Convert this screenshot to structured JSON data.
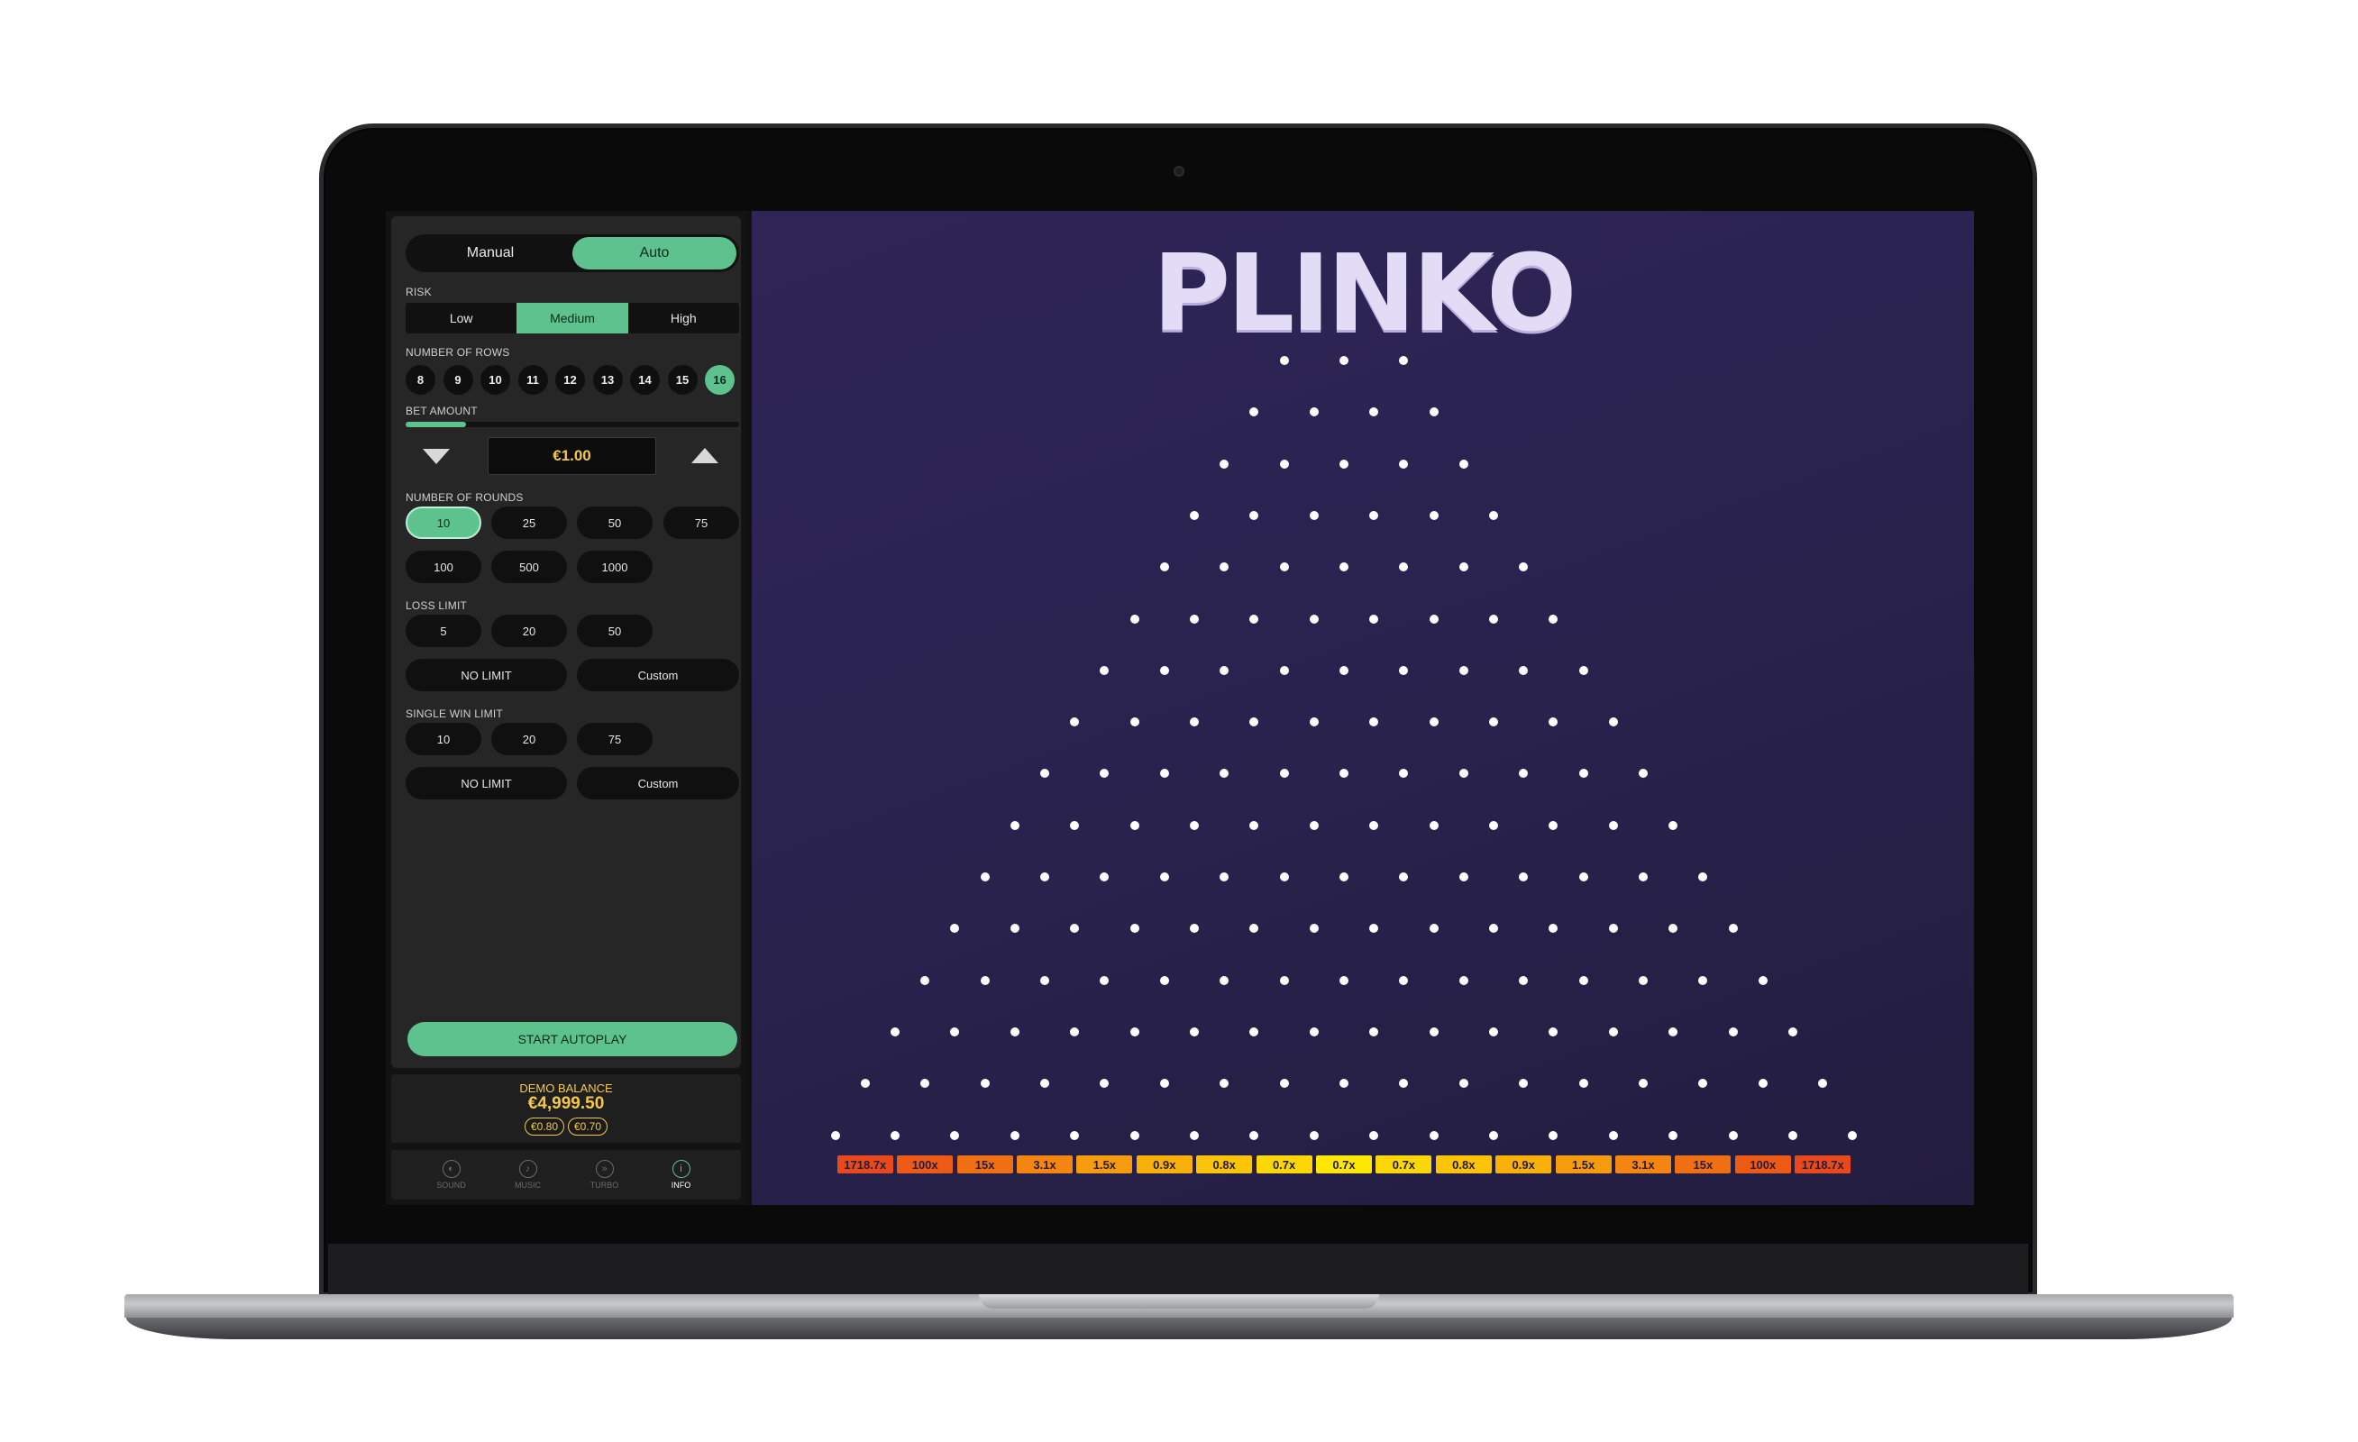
{
  "mode": {
    "manual": "Manual",
    "auto": "Auto",
    "active": "auto"
  },
  "risk": {
    "label": "RISK",
    "options": [
      "Low",
      "Medium",
      "High"
    ],
    "selected": "Medium"
  },
  "rows": {
    "label": "NUMBER OF ROWS",
    "options": [
      "8",
      "9",
      "10",
      "11",
      "12",
      "13",
      "14",
      "15",
      "16"
    ],
    "selected": "16"
  },
  "bet": {
    "label": "BET AMOUNT",
    "value": "€1.00",
    "slider_fraction": 0.18
  },
  "rounds": {
    "label": "NUMBER OF ROUNDS",
    "options": [
      "10",
      "25",
      "50",
      "75",
      "100",
      "500",
      "1000"
    ],
    "selected": "10"
  },
  "loss_limit": {
    "label": "LOSS LIMIT",
    "options": [
      "5",
      "20",
      "50"
    ],
    "no_limit": "NO LIMIT",
    "custom": "Custom"
  },
  "win_limit": {
    "label": "SINGLE WIN LIMIT",
    "options": [
      "10",
      "20",
      "75"
    ],
    "no_limit": "NO LIMIT",
    "custom": "Custom"
  },
  "start_button": "START AUTOPLAY",
  "balance": {
    "title": "DEMO BALANCE",
    "value": "€4,999.50",
    "chips": [
      "€0.80",
      "€0.70"
    ]
  },
  "bottom_bar": [
    {
      "label": "SOUND",
      "icon": "sound-icon",
      "glyph": "◐",
      "active": false
    },
    {
      "label": "MUSIC",
      "icon": "music-icon",
      "glyph": "♪",
      "active": false
    },
    {
      "label": "TURBO",
      "icon": "turbo-icon",
      "glyph": "»",
      "active": false
    },
    {
      "label": "INFO",
      "icon": "info-icon",
      "glyph": "i",
      "active": true
    }
  ],
  "game": {
    "title": "PLINKO",
    "multipliers": [
      "1718.7x",
      "100x",
      "15x",
      "3.1x",
      "1.5x",
      "0.9x",
      "0.8x",
      "0.7x",
      "0.7x",
      "0.7x",
      "0.8x",
      "0.9x",
      "1.5x",
      "3.1x",
      "15x",
      "100x",
      "1718.7x"
    ],
    "slot_colors": [
      "#e8491a",
      "#ec5a16",
      "#f06f13",
      "#f38510",
      "#f69b0d",
      "#f9b10a",
      "#fbc408",
      "#fdd605",
      "#fee803",
      "#fdd605",
      "#fbc408",
      "#f9b10a",
      "#f69b0d",
      "#f38510",
      "#f06f13",
      "#ec5a16",
      "#e8491a"
    ],
    "colors": {
      "accent": "#5ec28f",
      "gold": "#f5c84a",
      "board": "#2a2350"
    }
  }
}
